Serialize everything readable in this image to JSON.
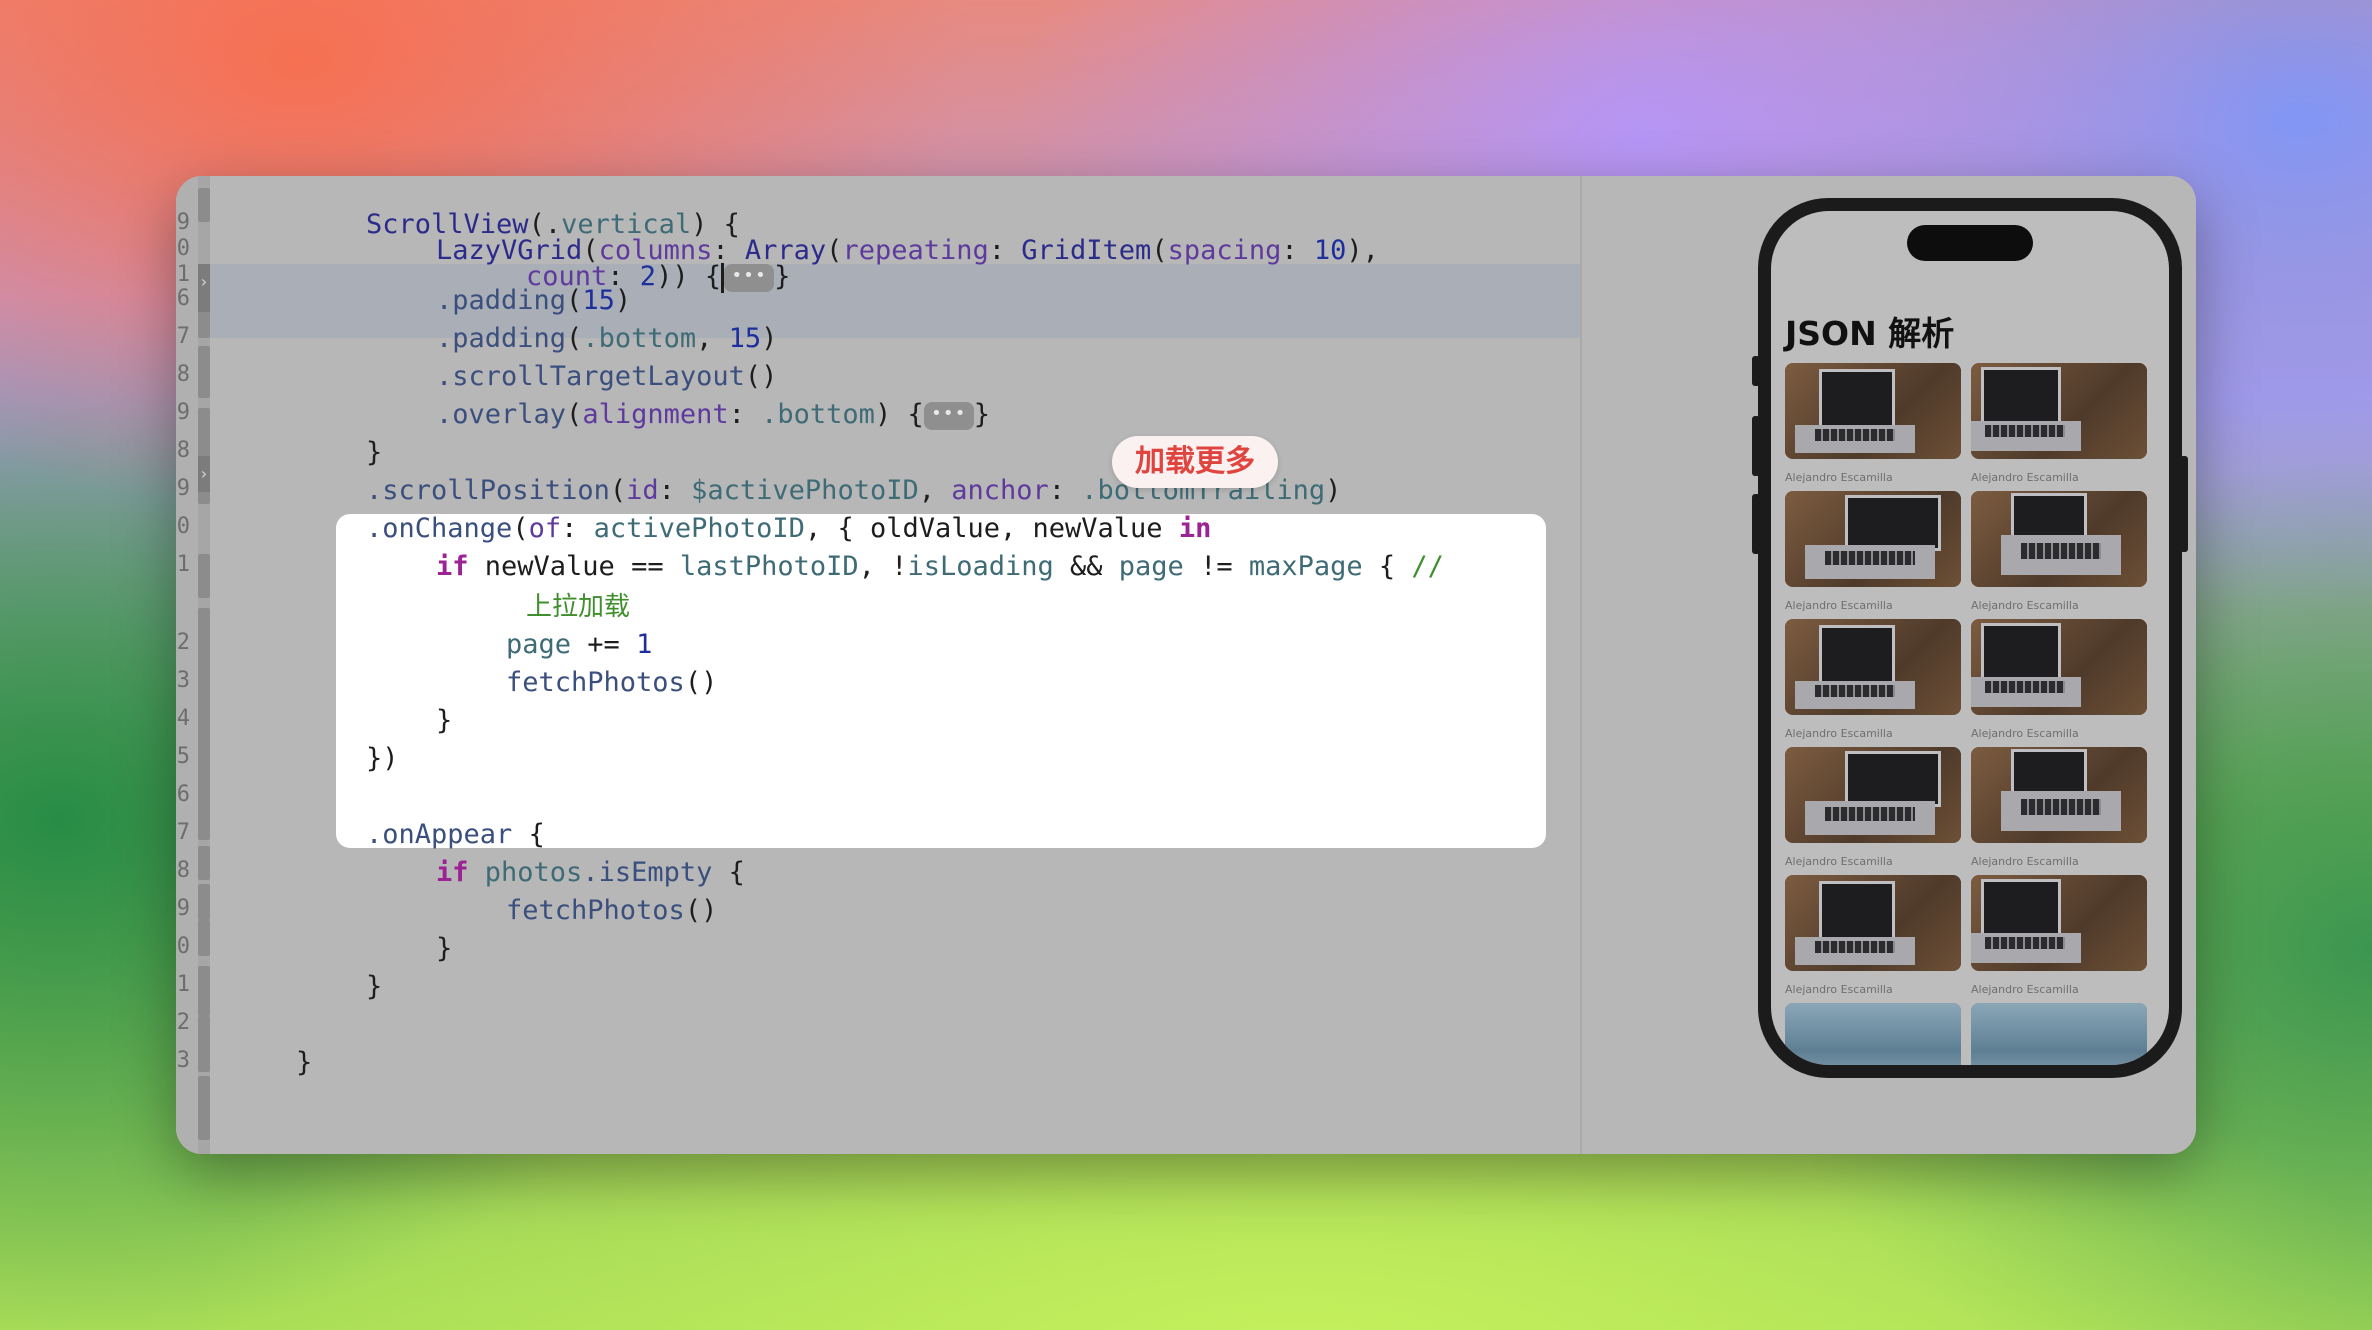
{
  "editor": {
    "line_numbers": [
      "9",
      "0",
      "1",
      "6",
      "7",
      "8",
      "9",
      "8",
      "9",
      "0",
      "1",
      "",
      "2",
      "3",
      "4",
      "5",
      "6",
      "7",
      "8",
      "9",
      "0",
      "1",
      "2",
      "3"
    ],
    "fold_placeholder": "•••",
    "code": {
      "l1_fn": "ScrollView",
      "l1_arg": "(.",
      "l1_val": "vertical",
      "l1_end": ") {",
      "l2_fn": "LazyVGrid",
      "l2_p1": "columns",
      "l2_ty": "Array",
      "l2_p2": "repeating",
      "l2_ty2": "GridItem",
      "l2_p3": "spacing",
      "l2_n1": "10",
      "l2_end": "),",
      "l3_p": "count",
      "l3_n": "2",
      "l3_end": ")) {",
      "l4_fn": ".padding",
      "l4_n": "15",
      "l5_fn": ".padding",
      "l5_val": ".bottom",
      "l5_n": "15",
      "l6_fn": ".scrollTargetLayout",
      "l6_end": "()",
      "l7_fn": ".overlay",
      "l7_p": "alignment",
      "l7_val": ".bottom",
      "l8": "}",
      "l9_fn": ".scrollPosition",
      "l9_p1": "id",
      "l9_v1": "$activePhotoID",
      "l9_p2": "anchor",
      "l9_v2": ".bottomTrailing",
      "l10_fn": ".onChange",
      "l10_p": "of",
      "l10_v": "activePhotoID",
      "l10_mid": ", { oldValue, newValue ",
      "l10_kw": "in",
      "l11_kw": "if",
      "l11_a": " newValue == ",
      "l11_v1": "lastPhotoID",
      "l11_b": ", !",
      "l11_v2": "isLoading",
      "l11_c": " && ",
      "l11_v3": "page",
      "l11_d": " != ",
      "l11_v4": "maxPage",
      "l11_e": " { ",
      "l11_cm": "//",
      "l12_cm": "上拉加载",
      "l13_v": "page",
      "l13_op": " += ",
      "l13_n": "1",
      "l14_fn": "fetchPhotos",
      "l14_end": "()",
      "l15": "}",
      "l16": "})",
      "l18_fn": ".onAppear",
      "l18_end": " {",
      "l19_kw": "if",
      "l19_v": "photos",
      "l19_fn": ".isEmpty",
      "l19_end": " {",
      "l20_fn": "fetchPhotos",
      "l20_end": "()",
      "l21": "}",
      "l22": "}",
      "l24": "}"
    },
    "badge": "加载更多"
  },
  "phone": {
    "title": "JSON 解析",
    "photos": [
      {
        "caption": "Alejandro Escamilla"
      },
      {
        "caption": "Alejandro Escamilla"
      },
      {
        "caption": "Alejandro Escamilla"
      },
      {
        "caption": "Alejandro Escamilla"
      },
      {
        "caption": "Alejandro Escamilla"
      },
      {
        "caption": "Alejandro Escamilla"
      },
      {
        "caption": "Alejandro Escamilla"
      },
      {
        "caption": "Alejandro Escamilla"
      },
      {
        "caption": "Alejandro Escamilla"
      },
      {
        "caption": "Alejandro Escamilla"
      },
      {
        "caption": ""
      },
      {
        "caption": ""
      }
    ]
  },
  "colors": {
    "keyword": "#9b2393",
    "comment": "#3f8f2d",
    "badge_text": "#e0443f"
  }
}
